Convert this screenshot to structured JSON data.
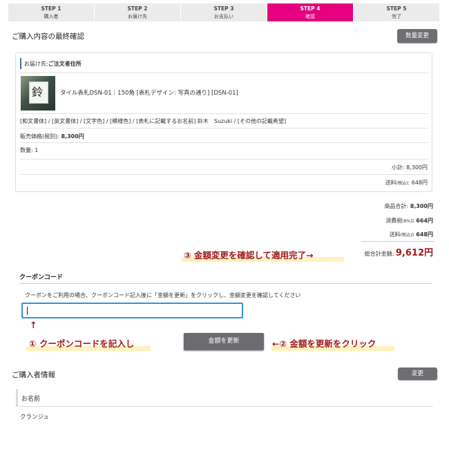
{
  "steps": [
    {
      "title": "STEP 1",
      "sub": "購入者"
    },
    {
      "title": "STEP 2",
      "sub": "お届け先"
    },
    {
      "title": "STEP 3",
      "sub": "お支払い"
    },
    {
      "title": "STEP 4",
      "sub": "確認",
      "active": true
    },
    {
      "title": "STEP 5",
      "sub": "完了"
    }
  ],
  "confirm": {
    "title": "ご購入内容の最終確認",
    "change_qty_label": "数量変更",
    "delivery_label": "お届け先:",
    "delivery_value": "ご注文者住所",
    "product_name": "タイル表札DSN-01｜150角 [表札デザイン: 写真の通り] [DSN-01]",
    "options": "[和文書体] / [英文書体] / [文字色] / [模様色] / [表札に記載するお名前] 鈴木　Suzuki / [その他の記載希望]",
    "price_label": "販売価格(税別):",
    "price_value": "8,300円",
    "qty_label": "数量:",
    "qty_value": "1",
    "subtotal_label": "小計:",
    "subtotal_value": "8,300円",
    "shipping_label": "送料",
    "shipping_tax": "(税込)",
    "shipping_value": ": 648円"
  },
  "summary": {
    "goods_label": "商品合計:",
    "goods_value": "8,300円",
    "tax_label": "消費税",
    "tax_rate": "(8%)",
    "tax_value": ": 664円",
    "ship_label": "送料",
    "ship_tax": "(税込)",
    "ship_value": ": 648円",
    "total_label": "総合計金額:",
    "total_value": "9,612円"
  },
  "annotations": {
    "step3": "③ 金額変更を確認して適用完了→",
    "step1": "① クーポンコードを記入し",
    "step2": "←② 金額を更新をクリック",
    "arrow": "↑"
  },
  "coupon": {
    "title": "クーポンコード",
    "desc": "クーポンをご利用の場合、クーポンコード記入後に「金額を更新」をクリックし、金額変更を確認してください",
    "input_value": "",
    "update_label": "金額を更新"
  },
  "buyer": {
    "title": "ご購入者情報",
    "change_label": "変更",
    "name_label": "お名前",
    "name_value": "クランジュ"
  },
  "colors": {
    "accent": "#e4007f",
    "annotation": "#a01a1a",
    "highlight": "#fdf2c0"
  }
}
